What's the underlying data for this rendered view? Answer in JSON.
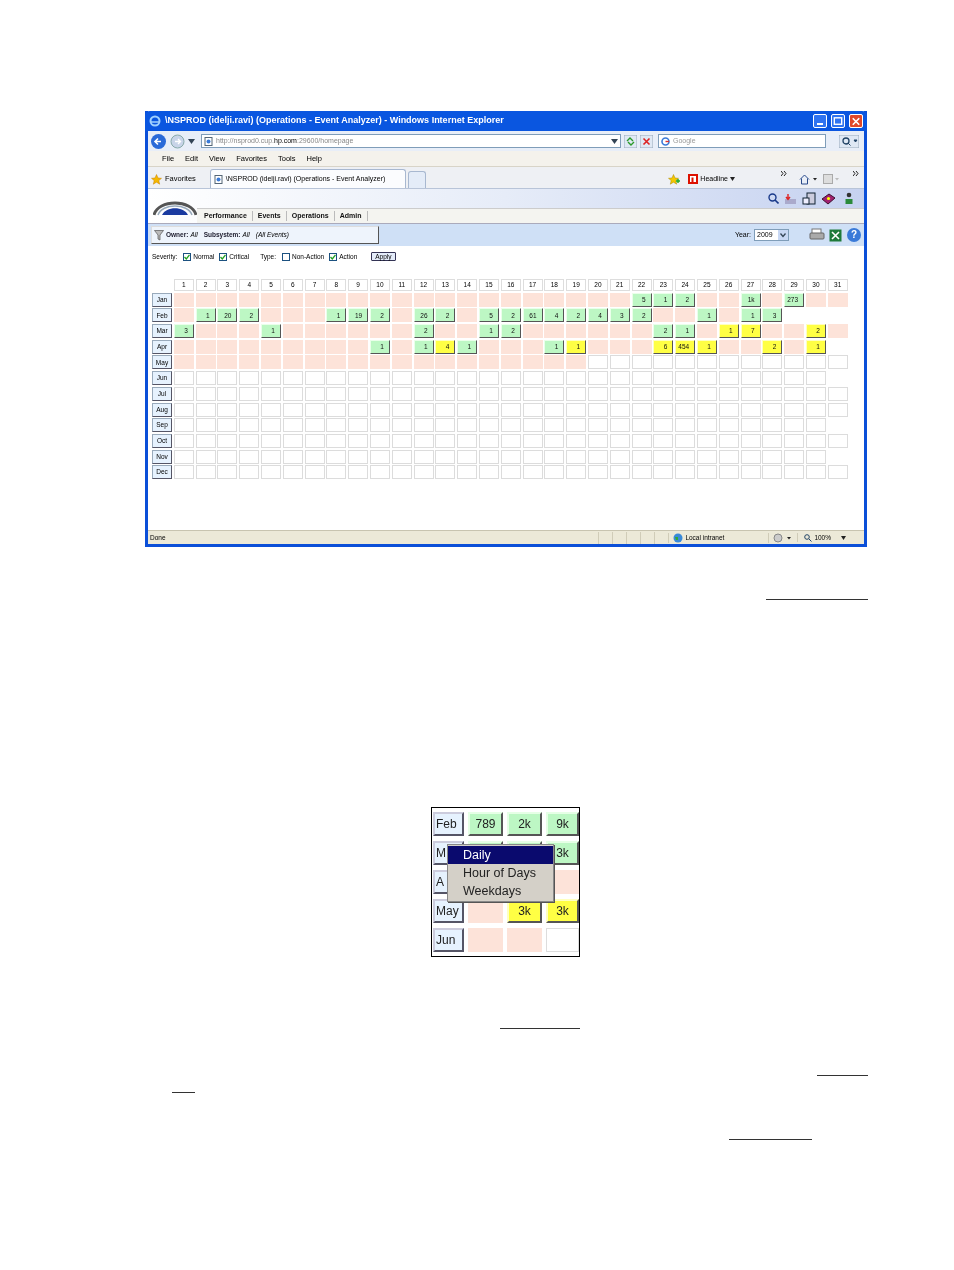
{
  "browser": {
    "title": "\\NSPROD (idelji.ravi) (Operations - Event Analyzer) - Windows Internet Explorer",
    "address": "http://nsprod0.cup.**hp.com**:29600/homepage",
    "search_placeholder": "Google",
    "menu": [
      "File",
      "Edit",
      "View",
      "Favorites",
      "Tools",
      "Help"
    ],
    "favorites": "Favorites",
    "tab_title": "\\NSPROD (idelji.ravi) (Operations - Event Analyzer)",
    "headline": "Headline",
    "status": "Done",
    "zone": "Local intranet",
    "zoom": "100%"
  },
  "app": {
    "nav": [
      "Performance",
      "Events",
      "Operations",
      "Admin"
    ],
    "filter": {
      "owner_label": "Owner:",
      "owner": "All",
      "subsystem_label": "Subsystem:",
      "subsystem": "All",
      "events": "(All Events)"
    },
    "year_label": "Year:",
    "year": "2009",
    "severity_label": "Severity:",
    "severity_options": [
      {
        "label": "Normal",
        "checked": true
      },
      {
        "label": "Critical",
        "checked": true
      }
    ],
    "type_label": "Type:",
    "type_options": [
      {
        "label": "Non-Action",
        "checked": false
      },
      {
        "label": "Action",
        "checked": true
      }
    ],
    "apply": "Apply",
    "help_icon": "?"
  },
  "calendar": {
    "days": [
      "1",
      "2",
      "3",
      "4",
      "5",
      "6",
      "7",
      "8",
      "9",
      "10",
      "11",
      "12",
      "13",
      "14",
      "15",
      "16",
      "17",
      "18",
      "19",
      "20",
      "21",
      "22",
      "23",
      "24",
      "25",
      "26",
      "27",
      "28",
      "29",
      "30",
      "31"
    ],
    "months": [
      {
        "label": "Jan",
        "cells": [
          {
            "kind": "past"
          },
          {
            "kind": "past"
          },
          {
            "kind": "past"
          },
          {
            "kind": "past"
          },
          {
            "kind": "past"
          },
          {
            "kind": "past"
          },
          {
            "kind": "past"
          },
          {
            "kind": "past"
          },
          {
            "kind": "past"
          },
          {
            "kind": "past"
          },
          {
            "kind": "past"
          },
          {
            "kind": "past"
          },
          {
            "kind": "past"
          },
          {
            "kind": "past"
          },
          {
            "kind": "past"
          },
          {
            "kind": "past"
          },
          {
            "kind": "past"
          },
          {
            "kind": "past"
          },
          {
            "kind": "past"
          },
          {
            "kind": "past"
          },
          {
            "kind": "past"
          },
          {
            "kind": "normal",
            "value": "5"
          },
          {
            "kind": "normal",
            "value": "1"
          },
          {
            "kind": "normal",
            "value": "2"
          },
          {
            "kind": "past"
          },
          {
            "kind": "past"
          },
          {
            "kind": "normal",
            "value": "1k"
          },
          {
            "kind": "past"
          },
          {
            "kind": "normal",
            "value": "273"
          },
          {
            "kind": "past"
          },
          {
            "kind": "past"
          }
        ]
      },
      {
        "label": "Feb",
        "cells": [
          {
            "kind": "past"
          },
          {
            "kind": "normal",
            "value": "1"
          },
          {
            "kind": "normal",
            "value": "20"
          },
          {
            "kind": "normal",
            "value": "2"
          },
          {
            "kind": "past"
          },
          {
            "kind": "past"
          },
          {
            "kind": "past"
          },
          {
            "kind": "normal",
            "value": "1"
          },
          {
            "kind": "normal",
            "value": "19"
          },
          {
            "kind": "normal",
            "value": "2"
          },
          {
            "kind": "past"
          },
          {
            "kind": "normal",
            "value": "26"
          },
          {
            "kind": "normal",
            "value": "2"
          },
          {
            "kind": "past"
          },
          {
            "kind": "normal",
            "value": "5"
          },
          {
            "kind": "normal",
            "value": "2"
          },
          {
            "kind": "normal",
            "value": "61"
          },
          {
            "kind": "normal",
            "value": "4"
          },
          {
            "kind": "normal",
            "value": "2"
          },
          {
            "kind": "normal",
            "value": "4"
          },
          {
            "kind": "normal",
            "value": "3"
          },
          {
            "kind": "normal",
            "value": "2"
          },
          {
            "kind": "past"
          },
          {
            "kind": "past"
          },
          {
            "kind": "normal",
            "value": "1"
          },
          {
            "kind": "past"
          },
          {
            "kind": "normal",
            "value": "1"
          },
          {
            "kind": "normal",
            "value": "3"
          }
        ]
      },
      {
        "label": "Mar",
        "cells": [
          {
            "kind": "normal",
            "value": "3"
          },
          {
            "kind": "past"
          },
          {
            "kind": "past"
          },
          {
            "kind": "past"
          },
          {
            "kind": "normal",
            "value": "1"
          },
          {
            "kind": "past"
          },
          {
            "kind": "past"
          },
          {
            "kind": "past"
          },
          {
            "kind": "past"
          },
          {
            "kind": "past"
          },
          {
            "kind": "past"
          },
          {
            "kind": "normal",
            "value": "2"
          },
          {
            "kind": "past"
          },
          {
            "kind": "past"
          },
          {
            "kind": "normal",
            "value": "1"
          },
          {
            "kind": "normal",
            "value": "2"
          },
          {
            "kind": "past"
          },
          {
            "kind": "past"
          },
          {
            "kind": "past"
          },
          {
            "kind": "past"
          },
          {
            "kind": "past"
          },
          {
            "kind": "past"
          },
          {
            "kind": "normal",
            "value": "2"
          },
          {
            "kind": "normal",
            "value": "1"
          },
          {
            "kind": "past"
          },
          {
            "kind": "critical",
            "value": "1"
          },
          {
            "kind": "critical",
            "value": "7"
          },
          {
            "kind": "past"
          },
          {
            "kind": "past"
          },
          {
            "kind": "critical",
            "value": "2"
          },
          {
            "kind": "past"
          }
        ]
      },
      {
        "label": "Apr",
        "cells": [
          {
            "kind": "past"
          },
          {
            "kind": "past"
          },
          {
            "kind": "past"
          },
          {
            "kind": "past"
          },
          {
            "kind": "past"
          },
          {
            "kind": "past"
          },
          {
            "kind": "past"
          },
          {
            "kind": "past"
          },
          {
            "kind": "past"
          },
          {
            "kind": "normal",
            "value": "1"
          },
          {
            "kind": "past"
          },
          {
            "kind": "normal",
            "value": "1"
          },
          {
            "kind": "critical",
            "value": "4"
          },
          {
            "kind": "normal",
            "value": "1"
          },
          {
            "kind": "past"
          },
          {
            "kind": "past"
          },
          {
            "kind": "past"
          },
          {
            "kind": "normal",
            "value": "1"
          },
          {
            "kind": "critical",
            "value": "1"
          },
          {
            "kind": "past"
          },
          {
            "kind": "past"
          },
          {
            "kind": "past"
          },
          {
            "kind": "critical",
            "value": "6"
          },
          {
            "kind": "critical",
            "value": "454"
          },
          {
            "kind": "critical",
            "value": "1"
          },
          {
            "kind": "past"
          },
          {
            "kind": "past"
          },
          {
            "kind": "critical",
            "value": "2"
          },
          {
            "kind": "past"
          },
          {
            "kind": "critical",
            "value": "1"
          }
        ]
      },
      {
        "label": "May",
        "cells": [
          {
            "kind": "past"
          },
          {
            "kind": "past"
          },
          {
            "kind": "past"
          },
          {
            "kind": "past"
          },
          {
            "kind": "past"
          },
          {
            "kind": "past"
          },
          {
            "kind": "past"
          },
          {
            "kind": "past"
          },
          {
            "kind": "past"
          },
          {
            "kind": "past"
          },
          {
            "kind": "past"
          },
          {
            "kind": "past"
          },
          {
            "kind": "past"
          },
          {
            "kind": "past"
          },
          {
            "kind": "past"
          },
          {
            "kind": "past"
          },
          {
            "kind": "past"
          },
          {
            "kind": "past"
          },
          {
            "kind": "past"
          },
          {
            "kind": "future"
          },
          {
            "kind": "future"
          },
          {
            "kind": "future"
          },
          {
            "kind": "future"
          },
          {
            "kind": "future"
          },
          {
            "kind": "future"
          },
          {
            "kind": "future"
          },
          {
            "kind": "future"
          },
          {
            "kind": "future"
          },
          {
            "kind": "future"
          },
          {
            "kind": "future"
          },
          {
            "kind": "future"
          }
        ]
      },
      {
        "label": "Jun",
        "cells": [
          {
            "kind": "future"
          },
          {
            "kind": "future"
          },
          {
            "kind": "future"
          },
          {
            "kind": "future"
          },
          {
            "kind": "future"
          },
          {
            "kind": "future"
          },
          {
            "kind": "future"
          },
          {
            "kind": "future"
          },
          {
            "kind": "future"
          },
          {
            "kind": "future"
          },
          {
            "kind": "future"
          },
          {
            "kind": "future"
          },
          {
            "kind": "future"
          },
          {
            "kind": "future"
          },
          {
            "kind": "future"
          },
          {
            "kind": "future"
          },
          {
            "kind": "future"
          },
          {
            "kind": "future"
          },
          {
            "kind": "future"
          },
          {
            "kind": "future"
          },
          {
            "kind": "future"
          },
          {
            "kind": "future"
          },
          {
            "kind": "future"
          },
          {
            "kind": "future"
          },
          {
            "kind": "future"
          },
          {
            "kind": "future"
          },
          {
            "kind": "future"
          },
          {
            "kind": "future"
          },
          {
            "kind": "future"
          },
          {
            "kind": "future"
          }
        ]
      },
      {
        "label": "Jul",
        "cells": [
          {
            "kind": "future"
          },
          {
            "kind": "future"
          },
          {
            "kind": "future"
          },
          {
            "kind": "future"
          },
          {
            "kind": "future"
          },
          {
            "kind": "future"
          },
          {
            "kind": "future"
          },
          {
            "kind": "future"
          },
          {
            "kind": "future"
          },
          {
            "kind": "future"
          },
          {
            "kind": "future"
          },
          {
            "kind": "future"
          },
          {
            "kind": "future"
          },
          {
            "kind": "future"
          },
          {
            "kind": "future"
          },
          {
            "kind": "future"
          },
          {
            "kind": "future"
          },
          {
            "kind": "future"
          },
          {
            "kind": "future"
          },
          {
            "kind": "future"
          },
          {
            "kind": "future"
          },
          {
            "kind": "future"
          },
          {
            "kind": "future"
          },
          {
            "kind": "future"
          },
          {
            "kind": "future"
          },
          {
            "kind": "future"
          },
          {
            "kind": "future"
          },
          {
            "kind": "future"
          },
          {
            "kind": "future"
          },
          {
            "kind": "future"
          },
          {
            "kind": "future"
          }
        ]
      },
      {
        "label": "Aug",
        "cells": [
          {
            "kind": "future"
          },
          {
            "kind": "future"
          },
          {
            "kind": "future"
          },
          {
            "kind": "future"
          },
          {
            "kind": "future"
          },
          {
            "kind": "future"
          },
          {
            "kind": "future"
          },
          {
            "kind": "future"
          },
          {
            "kind": "future"
          },
          {
            "kind": "future"
          },
          {
            "kind": "future"
          },
          {
            "kind": "future"
          },
          {
            "kind": "future"
          },
          {
            "kind": "future"
          },
          {
            "kind": "future"
          },
          {
            "kind": "future"
          },
          {
            "kind": "future"
          },
          {
            "kind": "future"
          },
          {
            "kind": "future"
          },
          {
            "kind": "future"
          },
          {
            "kind": "future"
          },
          {
            "kind": "future"
          },
          {
            "kind": "future"
          },
          {
            "kind": "future"
          },
          {
            "kind": "future"
          },
          {
            "kind": "future"
          },
          {
            "kind": "future"
          },
          {
            "kind": "future"
          },
          {
            "kind": "future"
          },
          {
            "kind": "future"
          },
          {
            "kind": "future"
          }
        ]
      },
      {
        "label": "Sep",
        "cells": [
          {
            "kind": "future"
          },
          {
            "kind": "future"
          },
          {
            "kind": "future"
          },
          {
            "kind": "future"
          },
          {
            "kind": "future"
          },
          {
            "kind": "future"
          },
          {
            "kind": "future"
          },
          {
            "kind": "future"
          },
          {
            "kind": "future"
          },
          {
            "kind": "future"
          },
          {
            "kind": "future"
          },
          {
            "kind": "future"
          },
          {
            "kind": "future"
          },
          {
            "kind": "future"
          },
          {
            "kind": "future"
          },
          {
            "kind": "future"
          },
          {
            "kind": "future"
          },
          {
            "kind": "future"
          },
          {
            "kind": "future"
          },
          {
            "kind": "future"
          },
          {
            "kind": "future"
          },
          {
            "kind": "future"
          },
          {
            "kind": "future"
          },
          {
            "kind": "future"
          },
          {
            "kind": "future"
          },
          {
            "kind": "future"
          },
          {
            "kind": "future"
          },
          {
            "kind": "future"
          },
          {
            "kind": "future"
          },
          {
            "kind": "future"
          }
        ]
      },
      {
        "label": "Oct",
        "cells": [
          {
            "kind": "future"
          },
          {
            "kind": "future"
          },
          {
            "kind": "future"
          },
          {
            "kind": "future"
          },
          {
            "kind": "future"
          },
          {
            "kind": "future"
          },
          {
            "kind": "future"
          },
          {
            "kind": "future"
          },
          {
            "kind": "future"
          },
          {
            "kind": "future"
          },
          {
            "kind": "future"
          },
          {
            "kind": "future"
          },
          {
            "kind": "future"
          },
          {
            "kind": "future"
          },
          {
            "kind": "future"
          },
          {
            "kind": "future"
          },
          {
            "kind": "future"
          },
          {
            "kind": "future"
          },
          {
            "kind": "future"
          },
          {
            "kind": "future"
          },
          {
            "kind": "future"
          },
          {
            "kind": "future"
          },
          {
            "kind": "future"
          },
          {
            "kind": "future"
          },
          {
            "kind": "future"
          },
          {
            "kind": "future"
          },
          {
            "kind": "future"
          },
          {
            "kind": "future"
          },
          {
            "kind": "future"
          },
          {
            "kind": "future"
          },
          {
            "kind": "future"
          }
        ]
      },
      {
        "label": "Nov",
        "cells": [
          {
            "kind": "future"
          },
          {
            "kind": "future"
          },
          {
            "kind": "future"
          },
          {
            "kind": "future"
          },
          {
            "kind": "future"
          },
          {
            "kind": "future"
          },
          {
            "kind": "future"
          },
          {
            "kind": "future"
          },
          {
            "kind": "future"
          },
          {
            "kind": "future"
          },
          {
            "kind": "future"
          },
          {
            "kind": "future"
          },
          {
            "kind": "future"
          },
          {
            "kind": "future"
          },
          {
            "kind": "future"
          },
          {
            "kind": "future"
          },
          {
            "kind": "future"
          },
          {
            "kind": "future"
          },
          {
            "kind": "future"
          },
          {
            "kind": "future"
          },
          {
            "kind": "future"
          },
          {
            "kind": "future"
          },
          {
            "kind": "future"
          },
          {
            "kind": "future"
          },
          {
            "kind": "future"
          },
          {
            "kind": "future"
          },
          {
            "kind": "future"
          },
          {
            "kind": "future"
          },
          {
            "kind": "future"
          },
          {
            "kind": "future"
          }
        ]
      },
      {
        "label": "Dec",
        "cells": [
          {
            "kind": "future"
          },
          {
            "kind": "future"
          },
          {
            "kind": "future"
          },
          {
            "kind": "future"
          },
          {
            "kind": "future"
          },
          {
            "kind": "future"
          },
          {
            "kind": "future"
          },
          {
            "kind": "future"
          },
          {
            "kind": "future"
          },
          {
            "kind": "future"
          },
          {
            "kind": "future"
          },
          {
            "kind": "future"
          },
          {
            "kind": "future"
          },
          {
            "kind": "future"
          },
          {
            "kind": "future"
          },
          {
            "kind": "future"
          },
          {
            "kind": "future"
          },
          {
            "kind": "future"
          },
          {
            "kind": "future"
          },
          {
            "kind": "future"
          },
          {
            "kind": "future"
          },
          {
            "kind": "future"
          },
          {
            "kind": "future"
          },
          {
            "kind": "future"
          },
          {
            "kind": "future"
          },
          {
            "kind": "future"
          },
          {
            "kind": "future"
          },
          {
            "kind": "future"
          },
          {
            "kind": "future"
          },
          {
            "kind": "future"
          },
          {
            "kind": "future"
          }
        ]
      }
    ]
  },
  "inset": {
    "rows": [
      {
        "label": "Feb",
        "cells": [
          {
            "kind": "normal",
            "value": "789"
          },
          {
            "kind": "normal",
            "value": "2k"
          },
          {
            "kind": "normal",
            "value": "9k"
          }
        ]
      },
      {
        "label": "M",
        "cells": [
          {
            "kind": "normal"
          },
          {
            "kind": "normal"
          },
          {
            "kind": "normal",
            "value": "3k"
          }
        ]
      },
      {
        "label": "A",
        "cells": [
          {
            "kind": "hidden"
          },
          {
            "kind": "hidden"
          },
          {
            "kind": "past"
          }
        ]
      },
      {
        "label": "May",
        "cells": [
          {
            "kind": "past"
          },
          {
            "kind": "critical",
            "value": "3k"
          },
          {
            "kind": "critical",
            "value": "3k"
          }
        ]
      },
      {
        "label": "Jun",
        "cells": [
          {
            "kind": "past"
          },
          {
            "kind": "past"
          },
          {
            "kind": "future"
          }
        ]
      }
    ],
    "menu": [
      {
        "label": "Daily",
        "selected": true
      },
      {
        "label": "Hour of Days",
        "selected": false
      },
      {
        "label": "Weekdays",
        "selected": false
      }
    ]
  }
}
